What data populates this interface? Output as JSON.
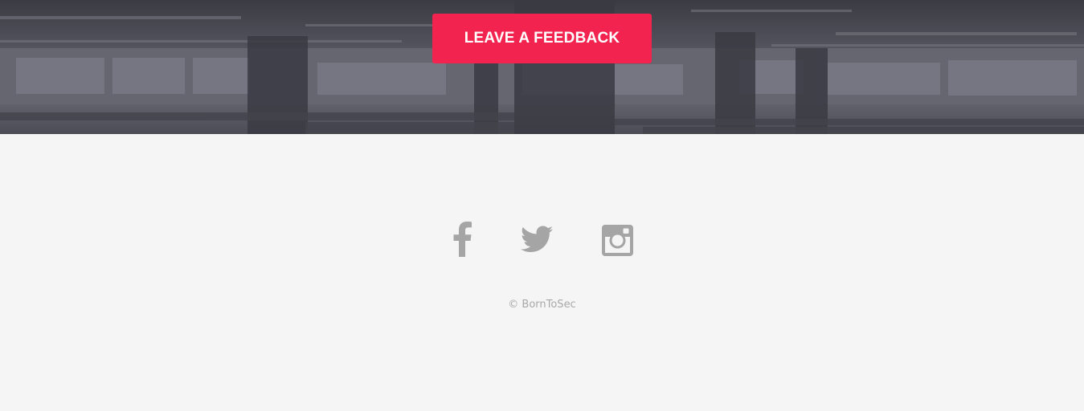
{
  "hero": {
    "background_description_icon": "office-floor-photo",
    "overlay_color": "#3d3d46"
  },
  "feedback_button": {
    "label": "LEAVE A FEEDBACK",
    "color": "#f2234f"
  },
  "footer": {
    "social": [
      {
        "name": "facebook",
        "icon": "facebook-icon"
      },
      {
        "name": "twitter",
        "icon": "twitter-icon"
      },
      {
        "name": "instagram",
        "icon": "instagram-icon"
      }
    ],
    "icon_color": "#a5a5a5",
    "copyright": "© BornToSec"
  }
}
